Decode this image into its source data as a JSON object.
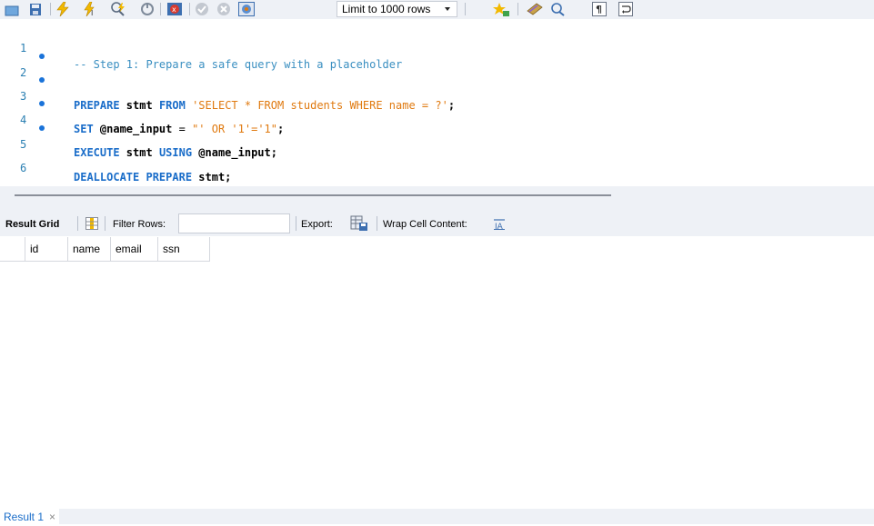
{
  "toolbar": {
    "icons": [
      "open-file-icon",
      "save-icon",
      "execute-icon",
      "execute-current-icon",
      "explain-icon",
      "stop-icon",
      "toggle-error-icon",
      "commit-icon",
      "rollback-icon",
      "autocommit-icon",
      "beautify-icon",
      "snippet-icon",
      "find-icon",
      "invisible-chars-icon",
      "word-wrap-icon"
    ],
    "limit_select": "Limit to 1000 rows"
  },
  "editor": {
    "lines": [
      {
        "num": "1",
        "marker": false
      },
      {
        "num": "2",
        "marker": true
      },
      {
        "num": "3",
        "marker": true
      },
      {
        "num": "4",
        "marker": true
      },
      {
        "num": "5",
        "marker": true
      },
      {
        "num": "6",
        "marker": false
      }
    ],
    "code": {
      "l1_comment": "-- Step 1: Prepare a safe query with a placeholder",
      "l2_kw1": "PREPARE",
      "l2_id1": " stmt ",
      "l2_kw2": "FROM",
      "l2_str": " 'SELECT * FROM students WHERE name = ?'",
      "l2_end": ";",
      "l3_kw": "SET",
      "l3_id": " @name_input ",
      "l3_op": "=",
      "l3_str1": " \"' OR '1'='1\"",
      "l3_end": ";",
      "l4_kw1": "EXECUTE",
      "l4_id1": " stmt ",
      "l4_kw2": "USING",
      "l4_id2": " @name_input;",
      "l5_kw": "DEALLOCATE PREPARE",
      "l5_id": " stmt;"
    }
  },
  "result_toolbar": {
    "result_grid_label": "Result Grid",
    "filter_rows_label": "Filter Rows:",
    "filter_value": "",
    "export_label": "Export:",
    "wrap_label": "Wrap Cell Content:"
  },
  "grid": {
    "columns": [
      "id",
      "name",
      "email",
      "ssn"
    ]
  },
  "tabs": {
    "result_tab": "Result 1",
    "close": "×"
  },
  "colors": {
    "keyword": "#1a6dc9",
    "string": "#e07a10",
    "comment": "#3a8fc1",
    "chrome": "#eef1f6"
  }
}
